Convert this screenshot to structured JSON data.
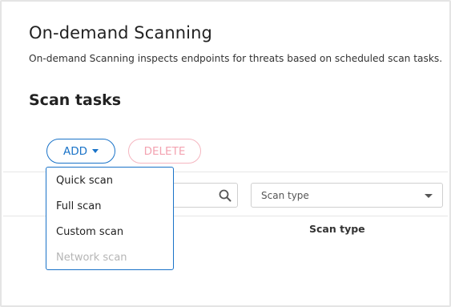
{
  "header": {
    "title": "On-demand Scanning",
    "description": "On-demand Scanning inspects endpoints for threats based on scheduled scan tasks."
  },
  "section": {
    "title": "Scan tasks"
  },
  "toolbar": {
    "add_label": "ADD",
    "delete_label": "DELETE"
  },
  "filters": {
    "search_value": "",
    "scan_type_placeholder": "Scan type"
  },
  "table": {
    "columns": [
      "Scan type"
    ]
  },
  "add_menu": {
    "items": [
      {
        "label": "Quick scan",
        "enabled": true
      },
      {
        "label": "Full scan",
        "enabled": true
      },
      {
        "label": "Custom scan",
        "enabled": true
      },
      {
        "label": "Network scan",
        "enabled": false
      }
    ]
  },
  "colors": {
    "accent": "#1a73c8",
    "delete_disabled": "#f3a3b1",
    "disabled_text": "#b5b5b5"
  }
}
